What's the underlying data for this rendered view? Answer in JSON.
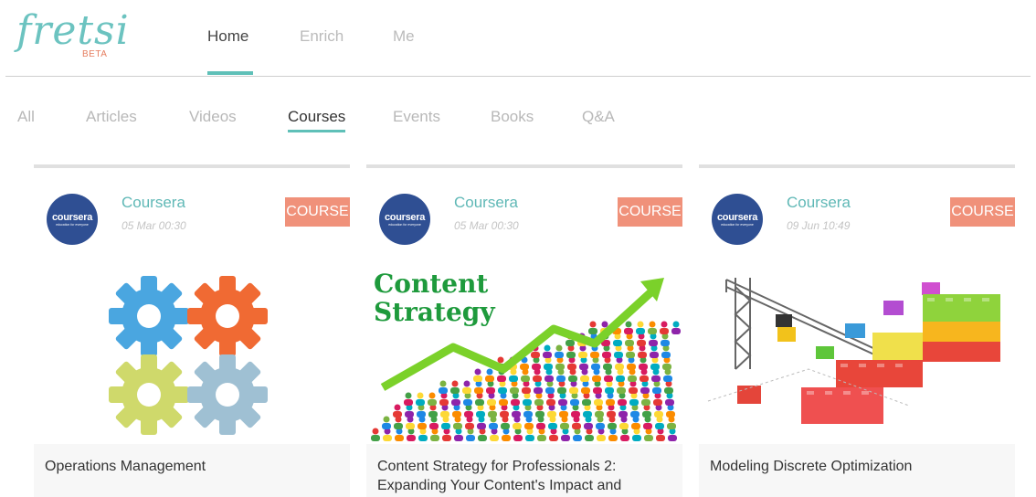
{
  "app": {
    "logo_text": "fretsi",
    "logo_badge": "BETA"
  },
  "top_nav": [
    {
      "label": "Home",
      "active": true
    },
    {
      "label": "Enrich",
      "active": false
    },
    {
      "label": "Me",
      "active": false
    }
  ],
  "categories": [
    {
      "label": "All",
      "active": false
    },
    {
      "label": "Articles",
      "active": false
    },
    {
      "label": "Videos",
      "active": false
    },
    {
      "label": "Courses",
      "active": true
    },
    {
      "label": "Events",
      "active": false
    },
    {
      "label": "Books",
      "active": false
    },
    {
      "label": "Q&A",
      "active": false
    }
  ],
  "cards": [
    {
      "provider": "Coursera",
      "avatar_text": "coursera",
      "avatar_subtext": "education for everyone",
      "date": "05 Mar 00:30",
      "badge": "COURSE",
      "image_icon": "gears-image",
      "title": "Operations Management"
    },
    {
      "provider": "Coursera",
      "avatar_text": "coursera",
      "avatar_subtext": "education for everyone",
      "date": "05 Mar 00:30",
      "badge": "COURSE",
      "image_icon": "content-strategy-image",
      "image_caption_line1": "Content",
      "image_caption_line2": "Strategy",
      "title": "Content Strategy for Professionals 2: Expanding Your Content's Impact and"
    },
    {
      "provider": "Coursera",
      "avatar_text": "coursera",
      "avatar_subtext": "education for everyone",
      "date": "09 Jun 10:49",
      "badge": "COURSE",
      "image_icon": "lego-crane-image",
      "title": "Modeling Discrete Optimization"
    }
  ],
  "colors": {
    "accent": "#5fc0b8",
    "badge": "#f0917a",
    "avatar": "#2f4f93",
    "logo_badge": "#e57d5f"
  }
}
